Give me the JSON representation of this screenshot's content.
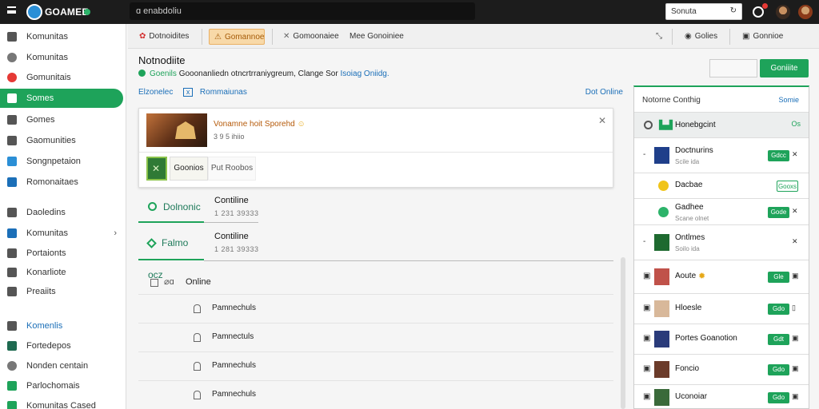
{
  "topbar": {
    "app_name": "GOAMEE",
    "search_text": "ɑ enabdoliu",
    "searchbox_label": "Sonuta",
    "searchbox_arrow": "↻"
  },
  "sidebar": {
    "items": [
      {
        "label": "Komunitas",
        "icon": "gamepad-icon"
      },
      {
        "label": "Komunitas",
        "icon": "globe-icon"
      },
      {
        "label": "Gomunitais",
        "icon": "record-icon"
      },
      {
        "label": "Somes",
        "icon": "grid-icon",
        "active": true
      },
      {
        "label": "Gomes",
        "icon": "chart-icon"
      },
      {
        "label": "Gaomunities",
        "icon": "chat-icon"
      },
      {
        "label": "Songnpetaion",
        "icon": "cloud-icon"
      },
      {
        "label": "Romonaitaes",
        "icon": "list-icon"
      },
      {
        "label": "Daoledins",
        "icon": "chest-icon"
      },
      {
        "label": "Komunitas",
        "icon": "window-icon",
        "chevron": "›"
      },
      {
        "label": "Portaionts",
        "icon": "folder-icon"
      },
      {
        "label": "Konarliote",
        "icon": "sliders-icon"
      },
      {
        "label": "Preaiits",
        "icon": "menu-icon"
      },
      {
        "label": "Komenlis",
        "icon": "box-icon",
        "blue": true
      },
      {
        "label": "Fortedepos",
        "icon": "badge-icon"
      },
      {
        "label": "Nonden centain",
        "icon": "gear-icon"
      },
      {
        "label": "Parlochomais",
        "icon": "image-icon"
      },
      {
        "label": "Komunitas Cased",
        "icon": "tag-icon"
      }
    ]
  },
  "tabs": [
    {
      "label": "Dotnoidites",
      "icon": "apps-icon"
    },
    {
      "label": "Gomannoe",
      "icon": "bell-icon",
      "selected": true
    },
    {
      "label": "Gomoonaiee",
      "icon": "pin-icon"
    },
    {
      "label": "Mee Gonoiniee",
      "icon": ""
    }
  ],
  "tabs_right": [
    {
      "label": "",
      "icon": "expand-icon"
    },
    {
      "label": "Golies",
      "icon": "profile-icon"
    },
    {
      "label": "Gonnioe",
      "icon": "settings-icon"
    }
  ],
  "main": {
    "title": "Notnodiite",
    "status": {
      "part1": "Goenils",
      "part2": "Gooonanliedn otncrtrraniygreum, Clange Sor",
      "part3": "Isoiag Oniidg."
    },
    "filters": {
      "label1": "Elzonelec",
      "label2": "Rommaiunas",
      "right": "Dot Online",
      "close": "x"
    },
    "card": {
      "title": "Vonamne hoit Sporehd",
      "title_emoji": "☺",
      "sub": "3 9 5 ihiio",
      "close": "✕",
      "btn1": "Goonios",
      "btn2": "Put Roobos",
      "thumb2_glyph": "✕"
    },
    "sections": [
      {
        "pill": "Dolnonic",
        "name": "Contiline",
        "num": "1 231 39333"
      },
      {
        "pill": "Falmo ocz",
        "name": "Contiline",
        "num": "1 281 39333"
      }
    ],
    "list_head": {
      "icon_text": "⌀ɑ",
      "label": "Online"
    },
    "list_rows": [
      "Pamnechuls",
      "Pamnectuls",
      "Pamnechuls",
      "Pamnechuls"
    ]
  },
  "right_buttons": {
    "btn2": "Goniiite"
  },
  "right_panel": {
    "head": {
      "title": "Notorne Conthig",
      "right": "Somie"
    },
    "sub": {
      "label": "Honebgcint",
      "right": "Os"
    },
    "rows": [
      {
        "lead": "-",
        "name": "Doctnurins",
        "sub": "Scile ida",
        "btn": "Gdcc",
        "right": "✕",
        "color": "#1f3f8a"
      },
      {
        "lead": "",
        "name": "Dacbae",
        "sub": "",
        "btn": "Gooxs",
        "right": "",
        "color": "#f0c419",
        "emoji": true
      },
      {
        "lead": "",
        "name": "Gadhee",
        "sub": "Scane olnet",
        "btn": "Gode",
        "right": "✕",
        "color": "#2db36a",
        "emoji": true
      },
      {
        "lead": "-",
        "name": "Ontlmes",
        "sub": "Soilo ida",
        "btn": "",
        "right": "✕",
        "color": "#1e6a30"
      },
      {
        "lead": "▣",
        "name": "Aoute",
        "sub": "",
        "btn": "Gle",
        "right": "▣",
        "color": "#c0524a",
        "star": "✹"
      },
      {
        "lead": "▣",
        "name": "Hloesle",
        "sub": "",
        "btn": "Gdo",
        "right": "▯",
        "color": "#d8b89a"
      },
      {
        "lead": "▣",
        "name": "Portes Goanotion",
        "sub": "",
        "btn": "Gdt",
        "right": "▣",
        "color": "#2a3b7a"
      },
      {
        "lead": "▣",
        "name": "Foncio",
        "sub": "",
        "btn": "Gdo",
        "right": "▣",
        "color": "#6b3b2a"
      },
      {
        "lead": "▣",
        "name": "Uconoiar",
        "sub": "",
        "btn": "Gdo",
        "right": "▣",
        "color": "#3a6a3a"
      }
    ]
  }
}
